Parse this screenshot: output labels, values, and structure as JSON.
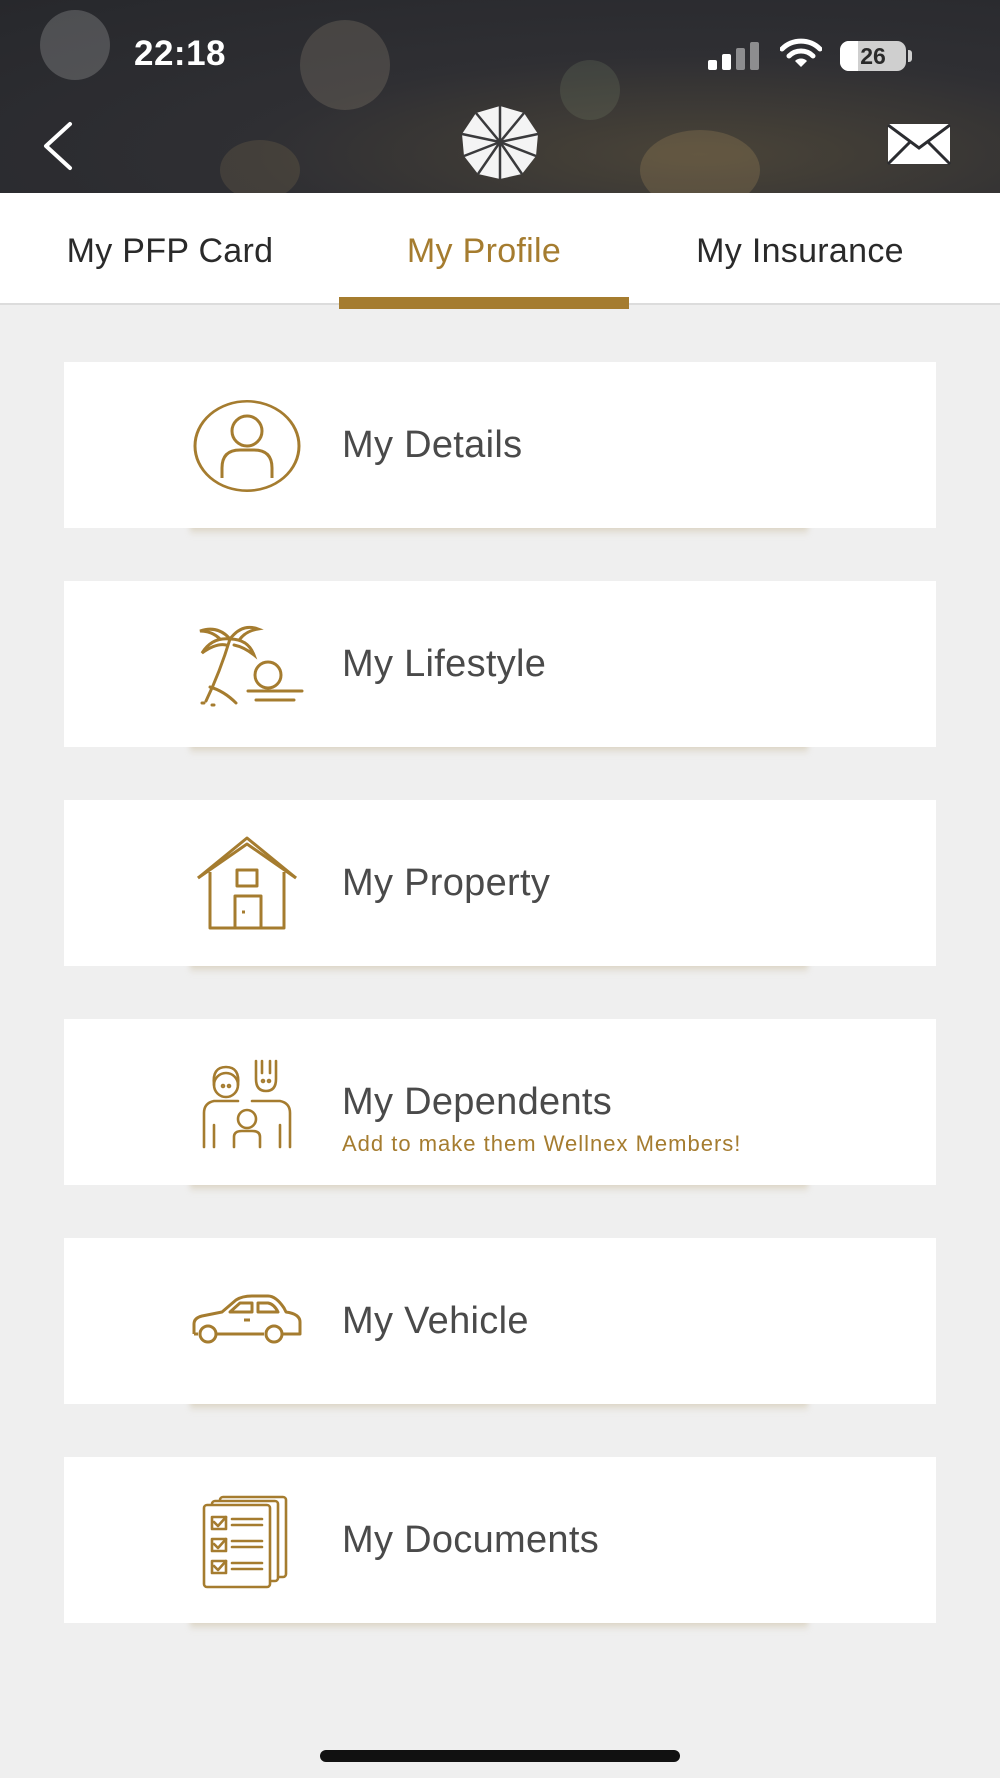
{
  "status_bar": {
    "time": "22:18",
    "battery": "26",
    "icons": [
      "cellular-signal-icon",
      "wifi-icon",
      "battery-icon"
    ]
  },
  "header": {
    "back_icon": "chevron-left-icon",
    "logo_icon": "umbrella-logo-icon",
    "mail_icon": "envelope-icon"
  },
  "tabs": [
    {
      "label": "My PFP Card",
      "active": false
    },
    {
      "label": "My Profile",
      "active": true
    },
    {
      "label": "My Insurance",
      "active": false
    }
  ],
  "menu": [
    {
      "label": "My Details",
      "icon": "person-circle-icon"
    },
    {
      "label": "My Lifestyle",
      "icon": "palm-tree-sunset-icon"
    },
    {
      "label": "My Property",
      "icon": "house-icon"
    },
    {
      "label": "My Dependents",
      "subtitle": "Add to make them Wellnex Members!",
      "icon": "family-icon"
    },
    {
      "label": "My Vehicle",
      "icon": "car-icon"
    },
    {
      "label": "My Documents",
      "icon": "documents-checklist-icon"
    }
  ],
  "colors": {
    "accent": "#a57c2f",
    "background": "#efefef",
    "header_bg": "#2b2c30",
    "text": "#4a4a4a"
  }
}
